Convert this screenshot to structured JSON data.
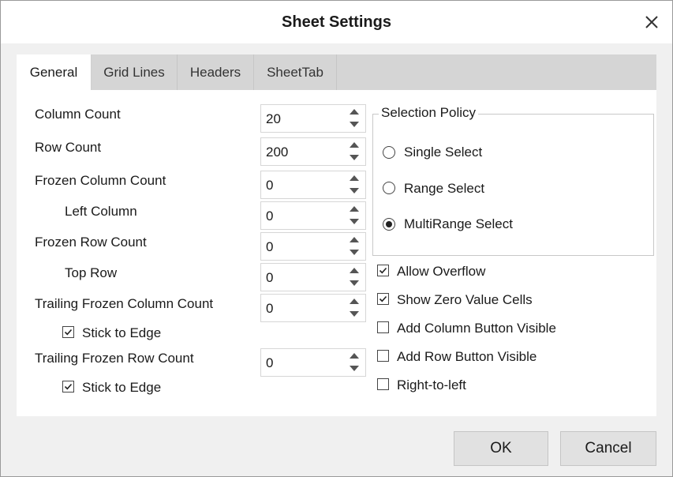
{
  "dialog": {
    "title": "Sheet Settings"
  },
  "tabs": [
    {
      "label": "General",
      "active": true
    },
    {
      "label": "Grid Lines",
      "active": false
    },
    {
      "label": "Headers",
      "active": false
    },
    {
      "label": "SheetTab",
      "active": false
    }
  ],
  "fields": {
    "column_count": {
      "label": "Column Count",
      "value": "20"
    },
    "row_count": {
      "label": "Row Count",
      "value": "200"
    },
    "frozen_column_count": {
      "label": "Frozen Column Count",
      "value": "0"
    },
    "left_column": {
      "label": "Left Column",
      "value": "0"
    },
    "frozen_row_count": {
      "label": "Frozen Row Count",
      "value": "0"
    },
    "top_row": {
      "label": "Top Row",
      "value": "0"
    },
    "trailing_frozen_column_count": {
      "label": "Trailing Frozen Column Count",
      "value": "0"
    },
    "trailing_col_stick": {
      "label": "Stick to Edge",
      "checked": true
    },
    "trailing_frozen_row_count": {
      "label": "Trailing Frozen Row Count",
      "value": "0"
    },
    "trailing_row_stick": {
      "label": "Stick to Edge",
      "checked": true
    }
  },
  "selection_policy": {
    "title": "Selection Policy",
    "options": [
      {
        "label": "Single Select",
        "selected": false
      },
      {
        "label": "Range Select",
        "selected": false
      },
      {
        "label": "MultiRange Select",
        "selected": true
      }
    ]
  },
  "options": [
    {
      "label": "Allow Overflow",
      "checked": true
    },
    {
      "label": "Show Zero Value Cells",
      "checked": true
    },
    {
      "label": "Add Column Button Visible",
      "checked": false
    },
    {
      "label": "Add Row Button Visible",
      "checked": false
    },
    {
      "label": "Right-to-left",
      "checked": false
    }
  ],
  "buttons": {
    "ok": "OK",
    "cancel": "Cancel"
  }
}
